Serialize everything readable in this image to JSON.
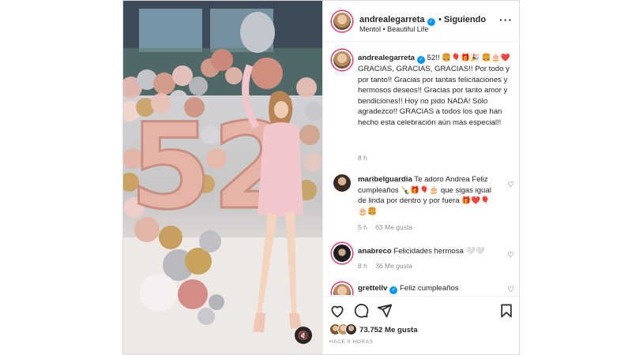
{
  "header": {
    "username": "andrealegarreta",
    "follow_status": "Siguiendo",
    "audio": "Mentol • Beautiful Life",
    "more_icon": "more-horizontal-icon"
  },
  "caption": {
    "username": "andrealegarreta",
    "text": "52!! 🍔🎈🎁🎉 🍔🎂❤️ GRACIAS, GRACIAS, GRACIAS!! Por todo y por tanto!! Gracias por tantas felicitaciones y hermosos deseos!! Gracias por tanto amor y bendiciones!! Hoy no pido NADA! Sólo agradezco!! GRACIAS a todos los que han hecho esta celebración aún más especial!!",
    "time": "8 h"
  },
  "comments": [
    {
      "username": "maribelguardia",
      "verified": false,
      "text": "Te adoro Andrea Feliz cumpleaños 🍾🎁🎈🎂 que sigas igual de linda por dentro y por fuera 🎁❤️🎈🎂🍔",
      "time": "5 h",
      "likes": "63 Me gusta"
    },
    {
      "username": "anabreco",
      "verified": false,
      "text": "Felicidades hermosa 🤍🤍",
      "time": "8 h",
      "likes": "36 Me gusta"
    },
    {
      "username": "grettellv",
      "verified": true,
      "text": "Feliz cumpleaños",
      "time": "",
      "likes": ""
    }
  ],
  "actions": {
    "like_icon": "heart-icon",
    "comment_icon": "comment-icon",
    "share_icon": "send-icon",
    "save_icon": "bookmark-icon"
  },
  "likes": {
    "count_text": "73.752 Me gusta"
  },
  "posted": "HACE 8 HORAS",
  "media": {
    "balloon_number": "52",
    "mute_icon": "speaker-muted-icon"
  },
  "colors": {
    "verified": "#0095f6",
    "story_ring": "#e1306c",
    "text": "#262626",
    "muted": "#8e8e8e"
  }
}
